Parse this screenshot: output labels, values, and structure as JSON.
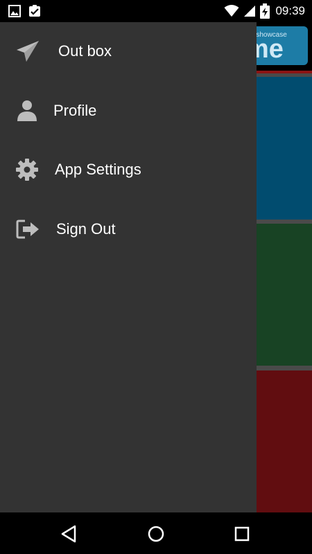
{
  "status_bar": {
    "time": "09:39",
    "left_icons": [
      "image-icon",
      "clipboard-check-icon"
    ],
    "right_icons": [
      "wifi-icon",
      "signal-icon",
      "battery-charging-icon"
    ]
  },
  "background_app": {
    "logo_small": "myshowcase",
    "logo_big": "me",
    "tile_colors": [
      "#014c6f",
      "#184324",
      "#610d10"
    ]
  },
  "drawer": {
    "background": "#333333",
    "items": [
      {
        "label": "Out box",
        "icon": "paper-plane-icon"
      },
      {
        "label": "Profile",
        "icon": "user-icon"
      },
      {
        "label": "App Settings",
        "icon": "gear-icon"
      },
      {
        "label": "Sign Out",
        "icon": "sign-out-icon"
      }
    ]
  },
  "nav_bar": {
    "buttons": [
      "back-icon",
      "home-icon",
      "recents-icon"
    ]
  }
}
